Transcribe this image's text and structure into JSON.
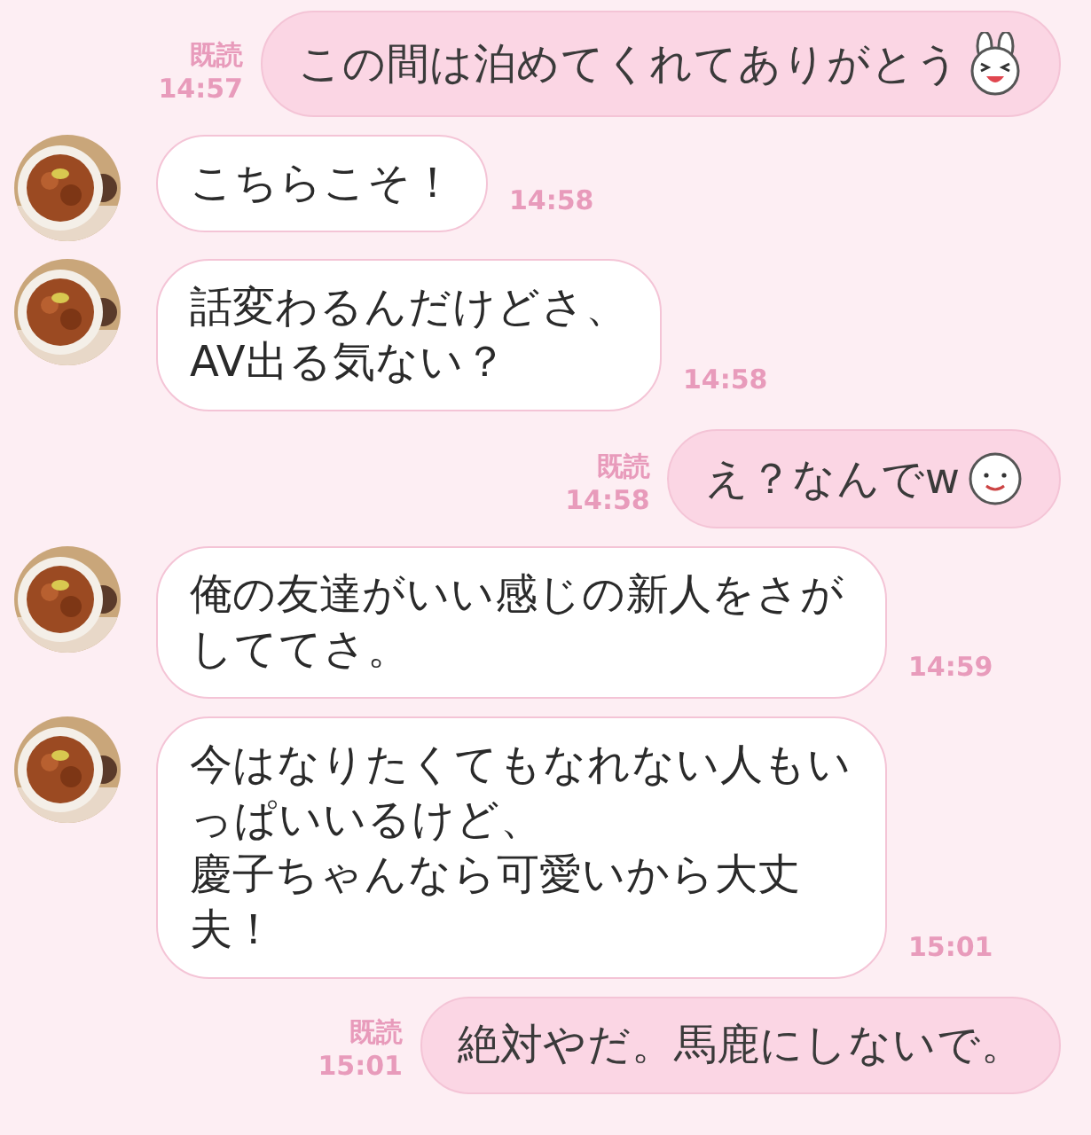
{
  "messages": [
    {
      "kind": "sent",
      "text": "この間は泊めてくれてありがとう",
      "sticker": {
        "kind": "bunny"
      },
      "read": "既読",
      "time": "14:57"
    },
    {
      "kind": "received",
      "paragraphs": [
        "こちらこそ！"
      ],
      "time": "14:58"
    },
    {
      "kind": "received",
      "paragraphs": [
        "話変わるんだけどさ、",
        "AV出る気ない？"
      ],
      "time": "14:58"
    },
    {
      "kind": "sent",
      "text": "え？なんでw",
      "sticker": {
        "kind": "face"
      },
      "read": "既読",
      "time": "14:58"
    },
    {
      "kind": "received",
      "paragraphs": [
        "俺の友達がいい感じの新人をさがしててさ。"
      ],
      "time": "14:59"
    },
    {
      "kind": "received",
      "paragraphs": [
        "今はなりたくてもなれない人もいっぱいいるけど、",
        "慶子ちゃんなら可愛いから大丈夫！"
      ],
      "time": "15:01"
    },
    {
      "kind": "sent",
      "text": "絶対やだ。馬鹿にしないで。",
      "read": "既読",
      "time": "15:01"
    }
  ]
}
